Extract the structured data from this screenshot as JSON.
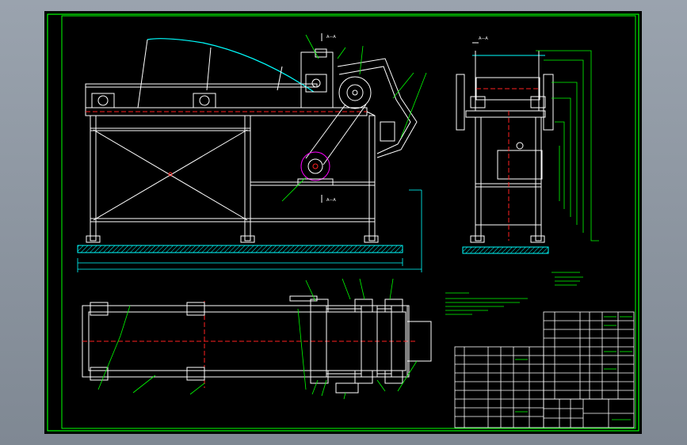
{
  "drawing": {
    "section_label_main": "A—A",
    "section_label_side": "A—A",
    "palette": {
      "background": "#000000",
      "frame": "#00ff00",
      "geometry": "#ffffff",
      "center_line": "#ff2020",
      "leader": "#00ff00",
      "dimension": "#00ffff",
      "highlight": "#ff00ff",
      "viewport": "#8f98a3"
    }
  }
}
